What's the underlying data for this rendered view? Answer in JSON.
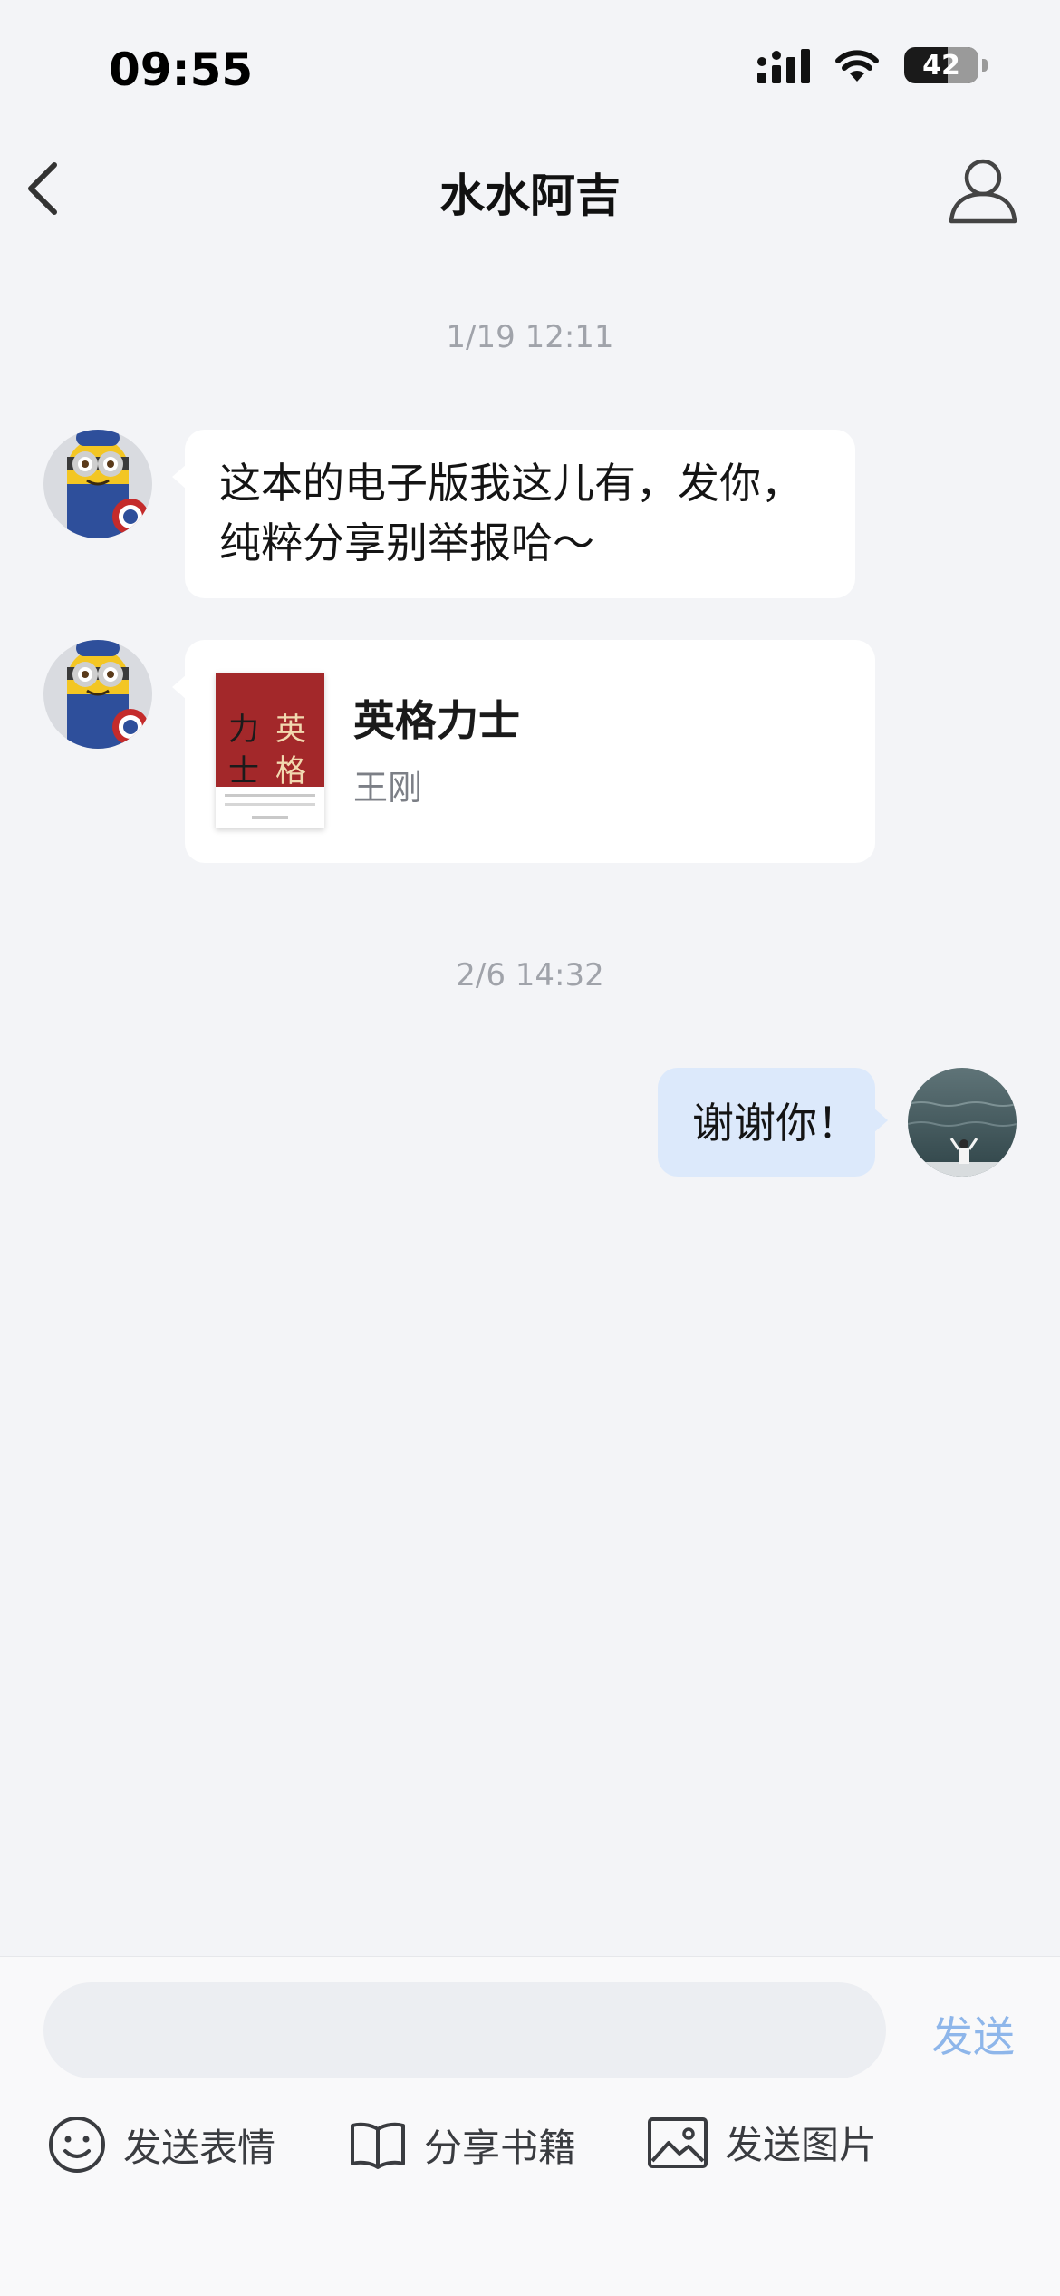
{
  "status_bar": {
    "time": "09:55",
    "battery": "42"
  },
  "nav": {
    "title": "水水阿吉"
  },
  "messages": {
    "ts1": "1/19 12:11",
    "msg1": {
      "line1": "这本的电子版我这儿有，发你，",
      "line2": "纯粹分享别举报哈～"
    },
    "book": {
      "title": "英格力士",
      "author": "王刚",
      "cover_chars": [
        "英",
        "格",
        "力",
        "士"
      ]
    },
    "ts2": "2/6 14:32",
    "msg2": "谢谢你！"
  },
  "composer": {
    "placeholder": "",
    "send_label": "发送",
    "tools": {
      "emoji": "发送表情",
      "share_book": "分享书籍",
      "image": "发送图片"
    }
  },
  "colors": {
    "background": "#f3f4f7",
    "bubble_in": "#ffffff",
    "bubble_out": "#dce9fb",
    "send": "#8eb6ea",
    "cover_red": "#a3282a"
  }
}
